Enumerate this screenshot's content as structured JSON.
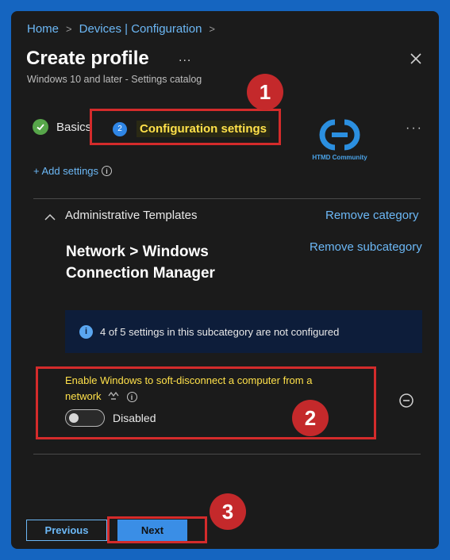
{
  "breadcrumb": {
    "items": [
      "Home",
      "Devices | Configuration"
    ],
    "separator": ">"
  },
  "header": {
    "title": "Create profile",
    "more": "...",
    "subtitle": "Windows 10 and later - Settings catalog"
  },
  "wizard": {
    "steps": [
      {
        "label": "Basics",
        "state": "complete",
        "icon": "check-icon"
      },
      {
        "label": "Configuration settings",
        "state": "current",
        "number": "2"
      }
    ],
    "more": "···"
  },
  "logo": {
    "text": "HTMD Community"
  },
  "add_settings": {
    "label": "+ Add settings",
    "info": "i"
  },
  "category": {
    "label": "Administrative Templates",
    "remove_label": "Remove category",
    "subcategory_title": "Network > Windows Connection Manager",
    "remove_subcategory_label": "Remove subcategory",
    "info_text": "4 of 5 settings in this subcategory are not configured",
    "setting": {
      "label": "Enable Windows to soft-disconnect a computer from a network",
      "toggle_label": "Disabled",
      "enabled": false
    }
  },
  "footer": {
    "previous_label": "Previous",
    "next_label": "Next"
  },
  "annotations": {
    "badge_1": "1",
    "badge_2": "2",
    "badge_3": "3"
  },
  "colors": {
    "accent": "#6cb8f6",
    "highlight_text": "#ffe14a",
    "annotation_red": "#d42b2b",
    "outer_background": "#1565c0",
    "panel_background": "#1b1b1b"
  }
}
